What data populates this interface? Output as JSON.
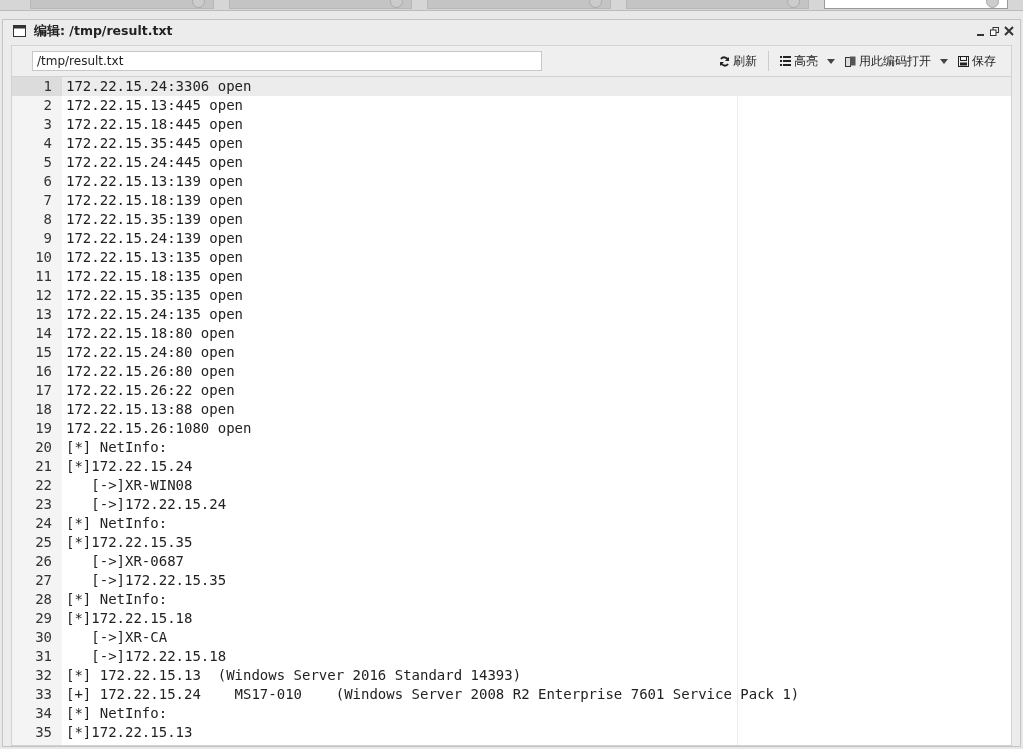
{
  "tabs": [
    {
      "selected": false
    },
    {
      "selected": false
    },
    {
      "selected": false
    },
    {
      "selected": false
    },
    {
      "selected": true
    }
  ],
  "window": {
    "title": "编辑: /tmp/result.txt"
  },
  "toolbar": {
    "path": "/tmp/result.txt",
    "buttons": [
      {
        "kind": "refresh",
        "label": "刷新",
        "dropdown": false
      },
      {
        "kind": "list",
        "label": "高亮",
        "dropdown": true
      },
      {
        "kind": "encoding",
        "label": "用此编码打开",
        "dropdown": true
      },
      {
        "kind": "save",
        "label": "保存",
        "dropdown": false
      }
    ]
  },
  "editor": {
    "lines": [
      {
        "number": "1",
        "text": "172.22.15.24:3306 open",
        "selected": true
      },
      {
        "number": "2",
        "text": "172.22.15.13:445 open",
        "selected": false
      },
      {
        "number": "3",
        "text": "172.22.15.18:445 open",
        "selected": false
      },
      {
        "number": "4",
        "text": "172.22.15.35:445 open",
        "selected": false
      },
      {
        "number": "5",
        "text": "172.22.15.24:445 open",
        "selected": false
      },
      {
        "number": "6",
        "text": "172.22.15.13:139 open",
        "selected": false
      },
      {
        "number": "7",
        "text": "172.22.15.18:139 open",
        "selected": false
      },
      {
        "number": "8",
        "text": "172.22.15.35:139 open",
        "selected": false
      },
      {
        "number": "9",
        "text": "172.22.15.24:139 open",
        "selected": false
      },
      {
        "number": "10",
        "text": "172.22.15.13:135 open",
        "selected": false
      },
      {
        "number": "11",
        "text": "172.22.15.18:135 open",
        "selected": false
      },
      {
        "number": "12",
        "text": "172.22.15.35:135 open",
        "selected": false
      },
      {
        "number": "13",
        "text": "172.22.15.24:135 open",
        "selected": false
      },
      {
        "number": "14",
        "text": "172.22.15.18:80 open",
        "selected": false
      },
      {
        "number": "15",
        "text": "172.22.15.24:80 open",
        "selected": false
      },
      {
        "number": "16",
        "text": "172.22.15.26:80 open",
        "selected": false
      },
      {
        "number": "17",
        "text": "172.22.15.26:22 open",
        "selected": false
      },
      {
        "number": "18",
        "text": "172.22.15.13:88 open",
        "selected": false
      },
      {
        "number": "19",
        "text": "172.22.15.26:1080 open",
        "selected": false
      },
      {
        "number": "20",
        "text": "[*] NetInfo:",
        "selected": false
      },
      {
        "number": "21",
        "text": "[*]172.22.15.24",
        "selected": false
      },
      {
        "number": "22",
        "text": "   [->]XR-WIN08",
        "selected": false
      },
      {
        "number": "23",
        "text": "   [->]172.22.15.24",
        "selected": false
      },
      {
        "number": "24",
        "text": "[*] NetInfo:",
        "selected": false
      },
      {
        "number": "25",
        "text": "[*]172.22.15.35",
        "selected": false
      },
      {
        "number": "26",
        "text": "   [->]XR-0687",
        "selected": false
      },
      {
        "number": "27",
        "text": "   [->]172.22.15.35",
        "selected": false
      },
      {
        "number": "28",
        "text": "[*] NetInfo:",
        "selected": false
      },
      {
        "number": "29",
        "text": "[*]172.22.15.18",
        "selected": false
      },
      {
        "number": "30",
        "text": "   [->]XR-CA",
        "selected": false
      },
      {
        "number": "31",
        "text": "   [->]172.22.15.18",
        "selected": false
      },
      {
        "number": "32",
        "text": "[*] 172.22.15.13  (Windows Server 2016 Standard 14393)",
        "selected": false
      },
      {
        "number": "33",
        "text": "[+] 172.22.15.24    MS17-010    (Windows Server 2008 R2 Enterprise 7601 Service Pack 1)",
        "selected": false
      },
      {
        "number": "34",
        "text": "[*] NetInfo:",
        "selected": false
      },
      {
        "number": "35",
        "text": "[*]172.22.15.13",
        "selected": false
      }
    ]
  }
}
